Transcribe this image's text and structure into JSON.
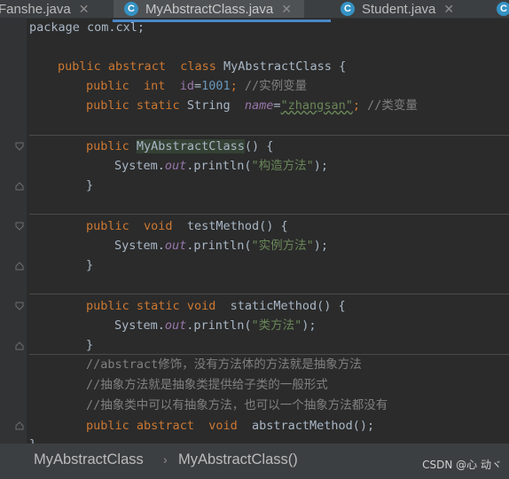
{
  "tabs": [
    {
      "label": "Fanshe.java",
      "icon": "close-icon"
    },
    {
      "label": "MyAbstractClass.java",
      "icon": "class-c-icon",
      "active": true
    },
    {
      "label": "Student.java",
      "icon": "class-c-icon"
    }
  ],
  "tab_close_symbol": "✕",
  "class_icon_letter": "C",
  "code": {
    "l0": "package com.cxl;",
    "decl_public": "public",
    "decl_abstract": "abstract",
    "decl_class": "class",
    "decl_name": "MyAbstractClass",
    "decl_brace": "{",
    "f1_type": "int",
    "f1_name": "id",
    "f1_eq": "=",
    "f1_val": "1001",
    "f1_semi": ";",
    "f1_comment": "//实例变量",
    "f2_static": "static",
    "f2_type": "String",
    "f2_name": "name",
    "f2_val": "\"zhangsan\"",
    "f2_comment": "//类变量",
    "ctor_name": "MyAbstractClass",
    "paren_brace": "() {",
    "sys": "System.",
    "out": "out",
    "println": ".println(",
    "close_call": ");",
    "ctor_str": "\"构造方法\"",
    "rbrace": "}",
    "void": "void",
    "m1_name": "testMethod",
    "m1_str": "\"实例方法\"",
    "m2_name": "staticMethod",
    "m2_str": "\"类方法\"",
    "c1": "//abstract修饰，没有方法体的方法就是抽象方法",
    "c2": "//抽象方法就是抽象类提供给子类的一般形式",
    "c3": "//抽象类中可以有抽象方法，也可以一个抽象方法都没有",
    "m3_name": "abstractMethod",
    "m3_tail": "();",
    "last": "}"
  },
  "breadcrumb": {
    "item1": "MyAbstractClass",
    "arrow": "›",
    "item2": "MyAbstractClass()"
  },
  "watermark": "CSDN @心 动ヾ",
  "colors": {
    "keyword": "#cc7832",
    "string": "#6a8759",
    "number": "#6897bb",
    "comment": "#808080",
    "field": "#9876aa",
    "method": "#ffc66d",
    "tab_underline": "#4a88c7"
  }
}
